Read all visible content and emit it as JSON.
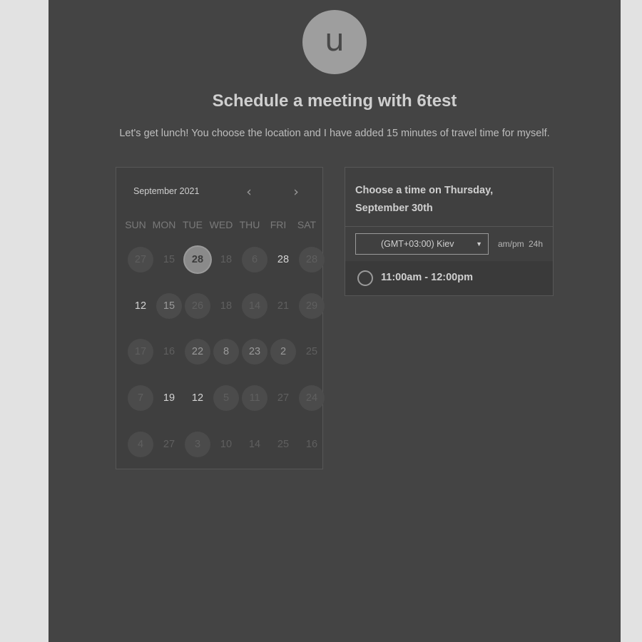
{
  "host": {
    "avatar_letter": "u",
    "title": "Schedule a meeting with 6test",
    "description": "Let's get lunch! You choose the location and I have added 15 minutes of travel time for myself."
  },
  "calendar": {
    "month_label": "September 2021",
    "prev_icon": "chevron-left-icon",
    "next_icon": "chevron-right-icon",
    "prev_glyph": "‹",
    "next_glyph": "›",
    "weekdays": [
      "SUN",
      "MON",
      "TUE",
      "WED",
      "THU",
      "FRI",
      "SAT"
    ],
    "weeks": [
      [
        "27",
        "15",
        "28",
        "18",
        "6",
        "28",
        "28"
      ],
      [
        "12",
        "15",
        "26",
        "18",
        "14",
        "21",
        "29"
      ],
      [
        "17",
        "16",
        "22",
        "8",
        "23",
        "2",
        "25"
      ],
      [
        "7",
        "19",
        "12",
        "5",
        "11",
        "27",
        "24"
      ],
      [
        "4",
        "27",
        "3",
        "10",
        "14",
        "25",
        "16"
      ]
    ]
  },
  "time_panel": {
    "heading_line1": "Choose a time on Thursday,",
    "heading_line2": "September 30th",
    "timezone": "(GMT+03:00) Kiev",
    "timezone_caret": "▼",
    "format_ampm": "am/pm",
    "format_24h": "24h",
    "slots": [
      "11:00am - 12:00pm"
    ]
  },
  "colors": {
    "page_bg": "#444444",
    "outer_bg": "#e2e2e2"
  }
}
